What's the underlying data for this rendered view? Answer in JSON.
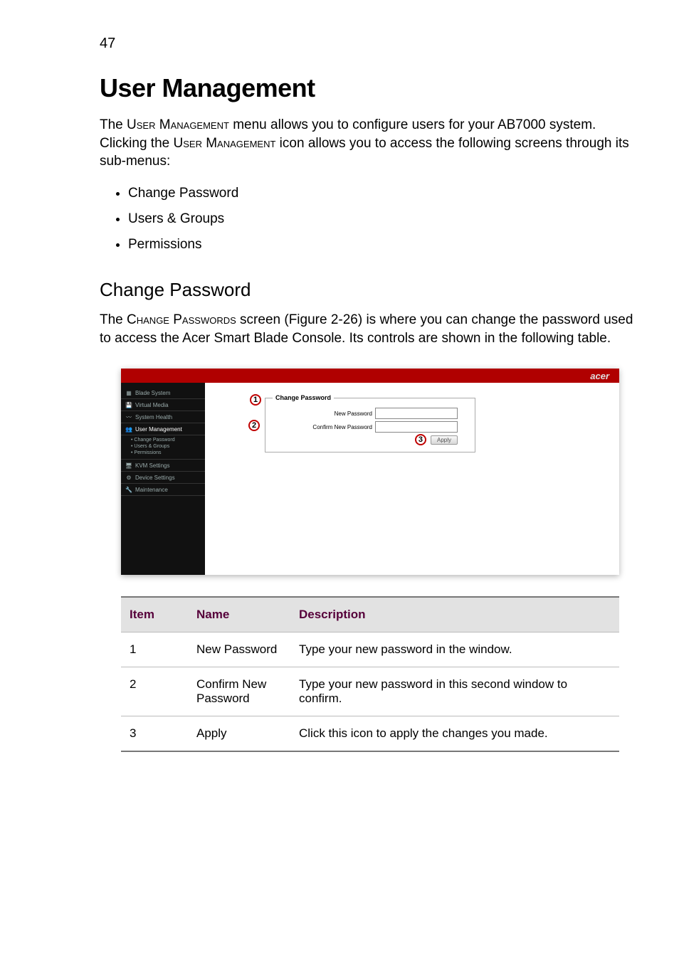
{
  "page_number": "47",
  "h1": "User Management",
  "intro_pre": "The ",
  "intro_sc1": "User Management",
  "intro_mid": " menu allows you to configure users for your AB7000 system. Clicking the ",
  "intro_sc2": "User Management",
  "intro_post": " icon allows you to access the following screens through its sub-menus:",
  "bullets": {
    "b1": "Change Password",
    "b2": "Users & Groups",
    "b3": "Permissions"
  },
  "h2": "Change Password",
  "cp_pre": "The ",
  "cp_sc": "Change Passwords",
  "cp_post": " screen (Figure 2-26) is where you can change the password used to access the Acer Smart Blade Console. Its controls are shown in the following table.",
  "brand": "acer",
  "sidebar": {
    "blade": "Blade System",
    "vmedia": "Virtual Media",
    "health": "System Health",
    "umgmt": "User Management",
    "sub_cp": "Change Password",
    "sub_ug": "Users & Groups",
    "sub_perm": "Permissions",
    "kvm": "KVM Settings",
    "device": "Device Settings",
    "maint": "Maintenance"
  },
  "form": {
    "legend": "Change Password",
    "new_pw_label": "New Password",
    "confirm_pw_label": "Confirm New Password",
    "apply": "Apply"
  },
  "callouts": {
    "c1": "1",
    "c2": "2",
    "c3": "3"
  },
  "table": {
    "hdr_item": "Item",
    "hdr_name": "Name",
    "hdr_desc": "Description",
    "r1_item": "1",
    "r1_name": "New Password",
    "r1_desc": "Type your new password in the window.",
    "r2_item": "2",
    "r2_name": "Confirm New Password",
    "r2_desc": "Type your new password in this second window to confirm.",
    "r3_item": "3",
    "r3_name": "Apply",
    "r3_desc": "Click this icon to apply the changes you made."
  }
}
